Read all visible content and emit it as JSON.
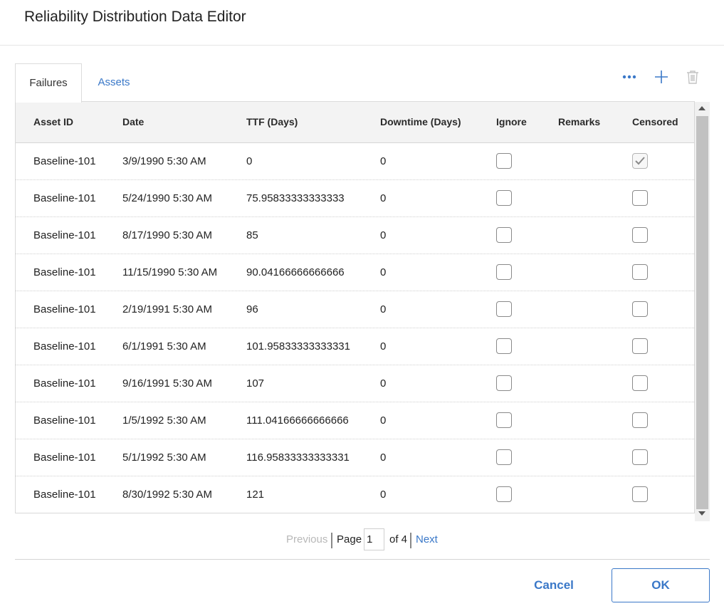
{
  "dialog": {
    "title": "Reliability Distribution Data Editor"
  },
  "tabs": [
    {
      "label": "Failures",
      "active": true
    },
    {
      "label": "Assets",
      "active": false
    }
  ],
  "toolbar": {
    "more_icon": "more-horizontal-icon",
    "add_icon": "plus-icon",
    "delete_icon": "trash-icon",
    "accent": "#3a78c8"
  },
  "table": {
    "columns": [
      "Asset ID",
      "Date",
      "TTF (Days)",
      "Downtime (Days)",
      "Ignore",
      "Remarks",
      "Censored"
    ],
    "rows": [
      {
        "asset_id": "Baseline-101",
        "date": "3/9/1990 5:30 AM",
        "ttf": "0",
        "downtime": "0",
        "ignore": false,
        "remarks": "",
        "censored": true
      },
      {
        "asset_id": "Baseline-101",
        "date": "5/24/1990 5:30 AM",
        "ttf": "75.95833333333333",
        "downtime": "0",
        "ignore": false,
        "remarks": "",
        "censored": false
      },
      {
        "asset_id": "Baseline-101",
        "date": "8/17/1990 5:30 AM",
        "ttf": "85",
        "downtime": "0",
        "ignore": false,
        "remarks": "",
        "censored": false
      },
      {
        "asset_id": "Baseline-101",
        "date": "11/15/1990 5:30 AM",
        "ttf": "90.04166666666666",
        "downtime": "0",
        "ignore": false,
        "remarks": "",
        "censored": false
      },
      {
        "asset_id": "Baseline-101",
        "date": "2/19/1991 5:30 AM",
        "ttf": "96",
        "downtime": "0",
        "ignore": false,
        "remarks": "",
        "censored": false
      },
      {
        "asset_id": "Baseline-101",
        "date": "6/1/1991 5:30 AM",
        "ttf": "101.95833333333331",
        "downtime": "0",
        "ignore": false,
        "remarks": "",
        "censored": false
      },
      {
        "asset_id": "Baseline-101",
        "date": "9/16/1991 5:30 AM",
        "ttf": "107",
        "downtime": "0",
        "ignore": false,
        "remarks": "",
        "censored": false
      },
      {
        "asset_id": "Baseline-101",
        "date": "1/5/1992 5:30 AM",
        "ttf": "111.04166666666666",
        "downtime": "0",
        "ignore": false,
        "remarks": "",
        "censored": false
      },
      {
        "asset_id": "Baseline-101",
        "date": "5/1/1992 5:30 AM",
        "ttf": "116.95833333333331",
        "downtime": "0",
        "ignore": false,
        "remarks": "",
        "censored": false
      },
      {
        "asset_id": "Baseline-101",
        "date": "8/30/1992 5:30 AM",
        "ttf": "121",
        "downtime": "0",
        "ignore": false,
        "remarks": "",
        "censored": false
      }
    ]
  },
  "pager": {
    "previous": "Previous",
    "page_label": "Page",
    "page_value": "1",
    "of_label": "of 4",
    "next": "Next"
  },
  "buttons": {
    "cancel": "Cancel",
    "ok": "OK"
  }
}
